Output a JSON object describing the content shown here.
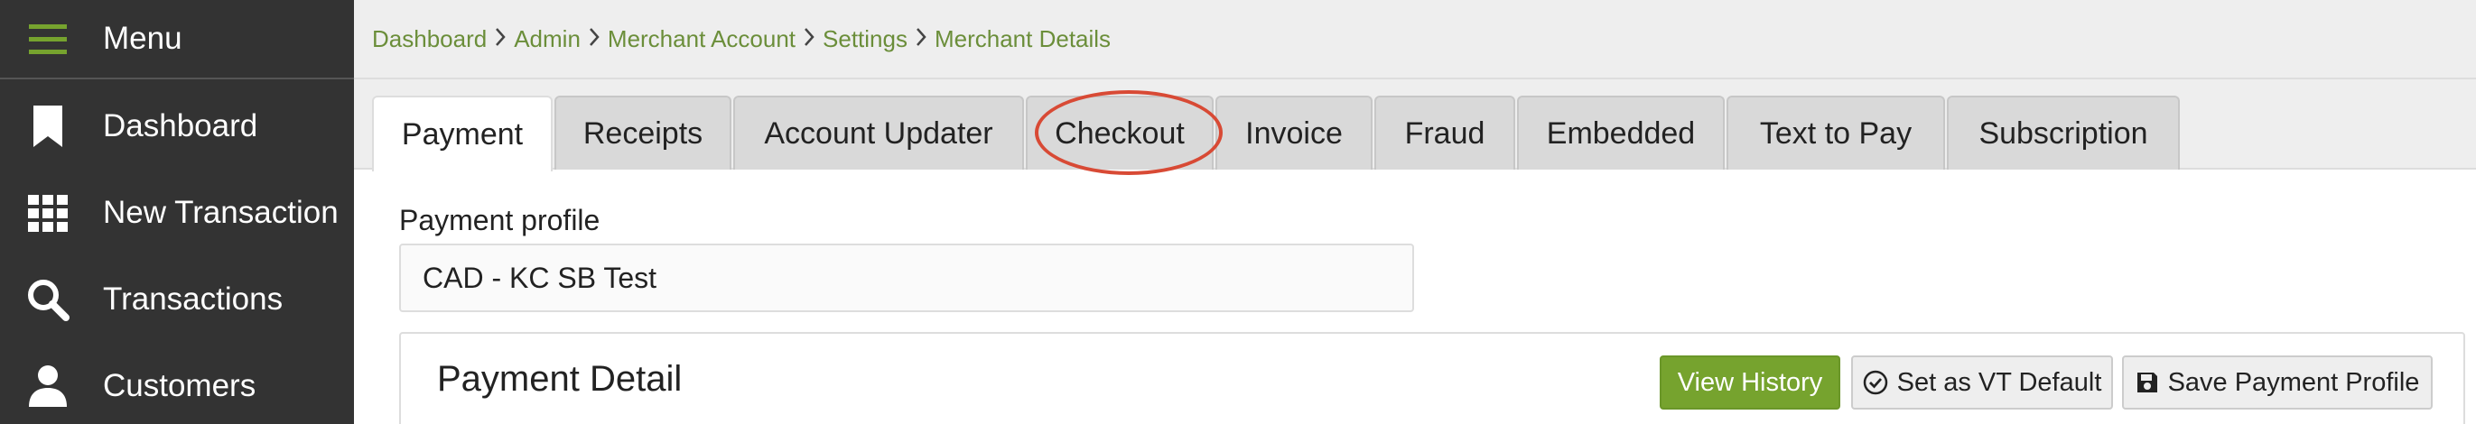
{
  "sidebar": {
    "menu_label": "Menu",
    "items": [
      {
        "label": "Dashboard",
        "icon": "bookmark-icon"
      },
      {
        "label": "New Transaction",
        "icon": "grid-icon"
      },
      {
        "label": "Transactions",
        "icon": "search-icon"
      },
      {
        "label": "Customers",
        "icon": "user-icon"
      }
    ]
  },
  "breadcrumb": [
    "Dashboard",
    "Admin",
    "Merchant Account",
    "Settings",
    "Merchant Details"
  ],
  "tabs": [
    {
      "label": "Payment",
      "active": true
    },
    {
      "label": "Receipts"
    },
    {
      "label": "Account Updater"
    },
    {
      "label": "Checkout",
      "highlighted": true
    },
    {
      "label": "Invoice"
    },
    {
      "label": "Fraud"
    },
    {
      "label": "Embedded"
    },
    {
      "label": "Text to Pay"
    },
    {
      "label": "Subscription"
    }
  ],
  "payment_profile": {
    "label": "Payment profile",
    "value": "CAD - KC SB Test"
  },
  "payment_detail": {
    "title": "Payment Detail",
    "view_history": "View History",
    "set_default": "Set as VT Default",
    "save_profile": "Save Payment Profile"
  },
  "colors": {
    "accent_green": "#76a32e",
    "sidebar_bg": "#333333",
    "breadcrumb_link": "#6b8e3a",
    "highlight_red": "#d84a35"
  }
}
